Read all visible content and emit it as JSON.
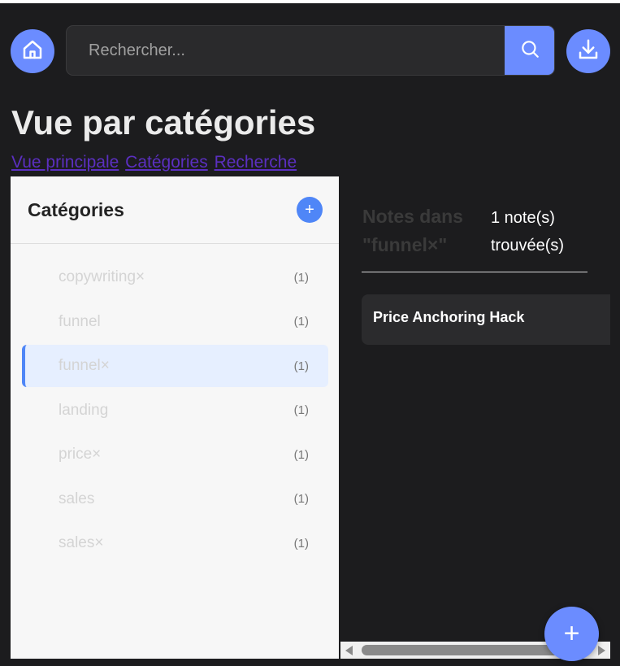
{
  "header": {
    "home_icon": "home-icon",
    "search": {
      "placeholder": "Rechercher...",
      "value": "",
      "icon": "search-icon"
    },
    "download_icon": "download-icon"
  },
  "page_title": "Vue par catégories",
  "tabs": [
    {
      "label": "Vue principale"
    },
    {
      "label": "Catégories"
    },
    {
      "label": "Recherche"
    }
  ],
  "sidebar": {
    "title": "Catégories",
    "add_label": "+",
    "items": [
      {
        "name": "copywriting×",
        "count": "(1)",
        "active": false
      },
      {
        "name": "funnel",
        "count": "(1)",
        "active": false
      },
      {
        "name": "funnel×",
        "count": "(1)",
        "active": true
      },
      {
        "name": "landing",
        "count": "(1)",
        "active": false
      },
      {
        "name": "price×",
        "count": "(1)",
        "active": false
      },
      {
        "name": "sales",
        "count": "(1)",
        "active": false
      },
      {
        "name": "sales×",
        "count": "(1)",
        "active": false
      }
    ]
  },
  "notes": {
    "title": "Notes dans \"funnel×\"",
    "count_text": "1 note(s) trouvée(s)",
    "items": [
      {
        "title": "Price Anchoring Hack"
      }
    ]
  },
  "fab_label": "+",
  "colors": {
    "accent": "#6b8cff",
    "accent_dark": "#4f86f7",
    "background": "#1c1c1e",
    "sidebar_bg": "#f7f7f7",
    "active_bg": "#e6efff",
    "link": "#5b2fc0"
  }
}
